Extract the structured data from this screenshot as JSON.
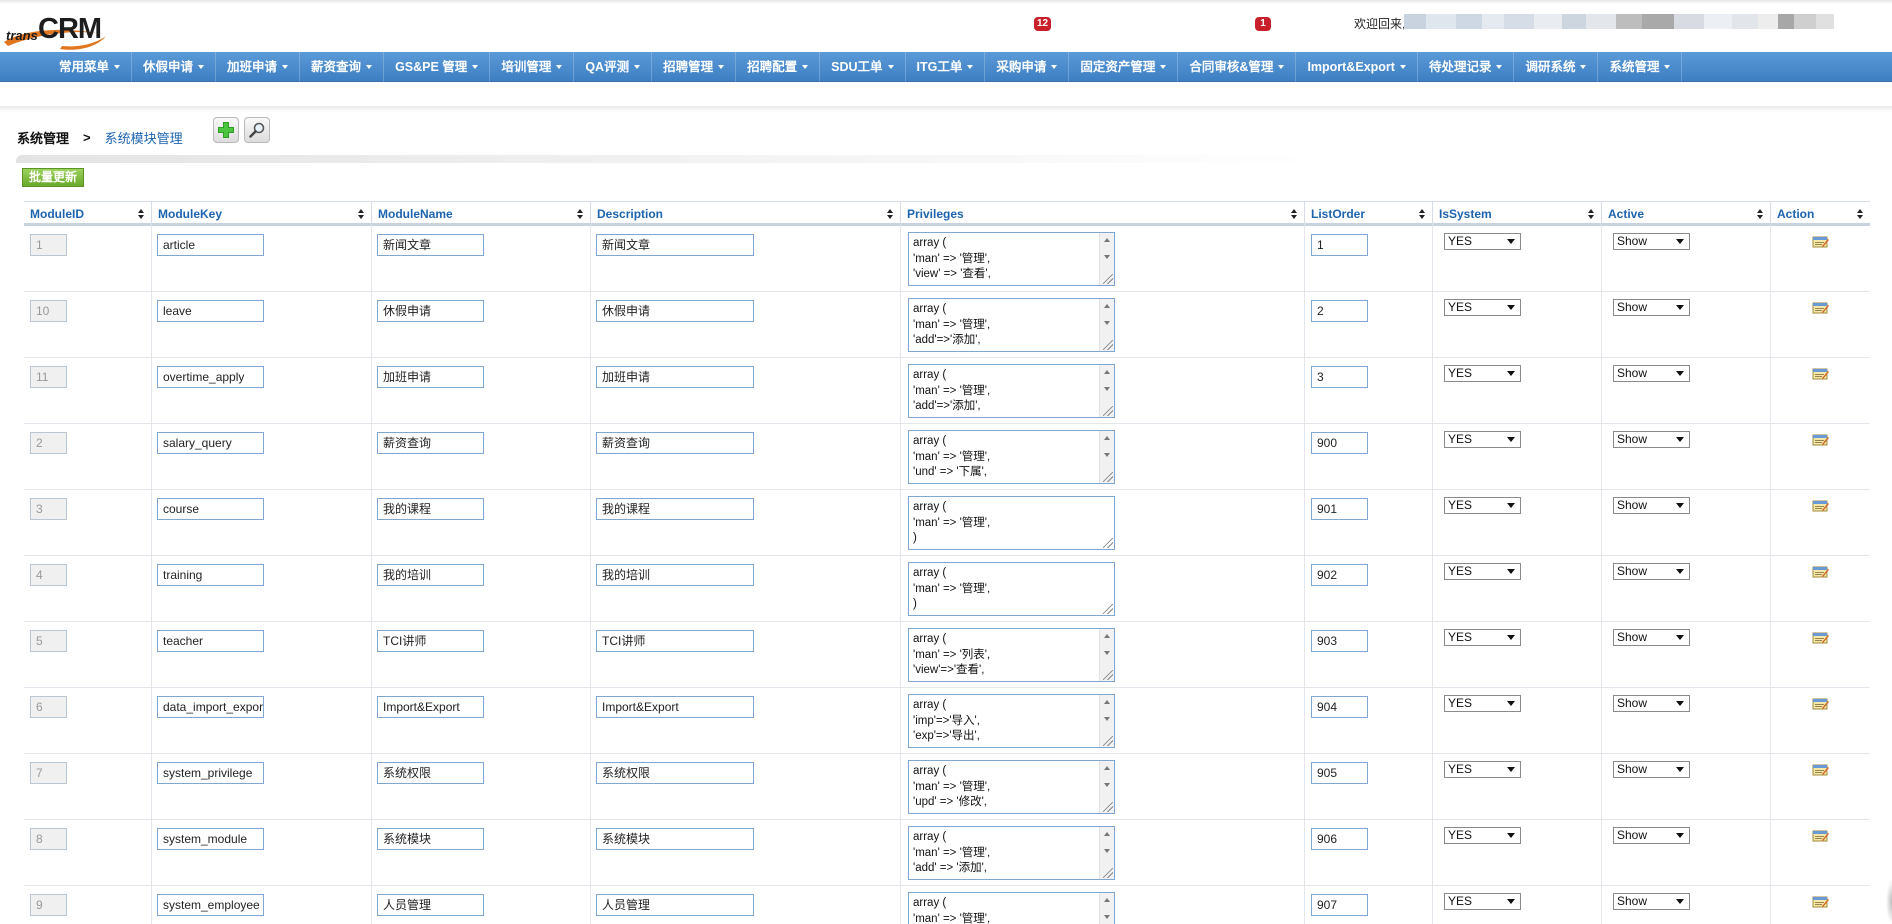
{
  "app": {
    "logo_prefix": "trans",
    "logo_main": "CRM",
    "notifications": [
      "12",
      "1"
    ],
    "welcome": "欢迎回来,"
  },
  "nav": [
    "常用菜单",
    "休假申请",
    "加班申请",
    "薪资查询",
    "GS&PE 管理",
    "培训管理",
    "QA评测",
    "招聘管理",
    "招聘配置",
    "SDU工单",
    "ITG工单",
    "采购申请",
    "固定资产管理",
    "合同审核&管理",
    "Import&Export",
    "待处理记录",
    "调研系统",
    "系统管理"
  ],
  "breadcrumb": {
    "root": "系统管理",
    "sep": ">",
    "current": "系统模块管理"
  },
  "toolbar": {
    "add_icon": "plus-icon",
    "search_icon": "magnifier-icon",
    "batch_update": "批量更新"
  },
  "table": {
    "headers": [
      "ModuleID",
      "ModuleKey",
      "ModuleName",
      "Description",
      "Privileges",
      "ListOrder",
      "IsSystem",
      "Active",
      "Action"
    ],
    "rows": [
      {
        "id": "1",
        "key": "article",
        "name": "新闻文章",
        "desc": "新闻文章",
        "priv": "array (\n'man' => '管理',\n'view' => '查看',",
        "order": "1",
        "sys": "YES",
        "active": "Show",
        "scroll": true
      },
      {
        "id": "10",
        "key": "leave",
        "name": "休假申请",
        "desc": "休假申请",
        "priv": "array (\n'man' => '管理',\n'add'=>'添加',",
        "order": "2",
        "sys": "YES",
        "active": "Show",
        "scroll": true
      },
      {
        "id": "11",
        "key": "overtime_apply",
        "name": "加班申请",
        "desc": "加班申请",
        "priv": "array (\n'man' => '管理',\n'add'=>'添加',",
        "order": "3",
        "sys": "YES",
        "active": "Show",
        "scroll": true
      },
      {
        "id": "2",
        "key": "salary_query",
        "name": "薪资查询",
        "desc": "薪资查询",
        "priv": "array (\n'man' => '管理',\n'und' => '下属',",
        "order": "900",
        "sys": "YES",
        "active": "Show",
        "scroll": true
      },
      {
        "id": "3",
        "key": "course",
        "name": "我的课程",
        "desc": "我的课程",
        "priv": "array (\n'man' => '管理',\n)",
        "order": "901",
        "sys": "YES",
        "active": "Show",
        "scroll": false
      },
      {
        "id": "4",
        "key": "training",
        "name": "我的培训",
        "desc": "我的培训",
        "priv": "array (\n'man' => '管理',\n)",
        "order": "902",
        "sys": "YES",
        "active": "Show",
        "scroll": false
      },
      {
        "id": "5",
        "key": "teacher",
        "name": "TCI讲师",
        "desc": "TCI讲师",
        "priv": "array (\n'man' => '列表',\n'view'=>'查看',",
        "order": "903",
        "sys": "YES",
        "active": "Show",
        "scroll": true
      },
      {
        "id": "6",
        "key": "data_import_expor",
        "name": "Import&Export",
        "desc": "Import&Export",
        "priv": "array (\n'imp'=>'导入',\n'exp'=>'导出',",
        "order": "904",
        "sys": "YES",
        "active": "Show",
        "scroll": true
      },
      {
        "id": "7",
        "key": "system_privilege",
        "name": "系统权限",
        "desc": "系统权限",
        "priv": "array (\n'man' => '管理',\n'upd' => '修改',",
        "order": "905",
        "sys": "YES",
        "active": "Show",
        "scroll": true
      },
      {
        "id": "8",
        "key": "system_module",
        "name": "系统模块",
        "desc": "系统模块",
        "priv": "array (\n'man' => '管理',\n'add' => '添加',",
        "order": "906",
        "sys": "YES",
        "active": "Show",
        "scroll": true
      },
      {
        "id": "9",
        "key": "system_employee",
        "name": "人员管理",
        "desc": "人员管理",
        "priv": "array (\n'man' => '管理',",
        "order": "907",
        "sys": "YES",
        "active": "Show",
        "scroll": true
      }
    ]
  },
  "colors": {
    "nav_top": "#5b9ad8",
    "nav_bottom": "#3d7fc3",
    "link": "#1c64b0",
    "badge": "#c8202b",
    "batch_btn": "#7fbb3c",
    "input_border": "#7fa7d1"
  }
}
